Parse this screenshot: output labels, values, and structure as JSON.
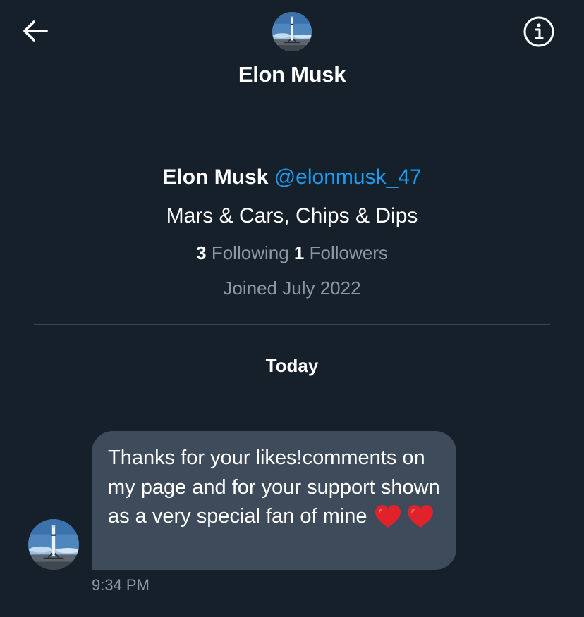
{
  "header": {
    "title": "Elon Musk",
    "back_icon": "arrow-left-icon",
    "info_icon": "info-circle-icon"
  },
  "profile": {
    "name": "Elon Musk",
    "handle": "@elonmusk_47",
    "bio": "Mars & Cars, Chips & Dips",
    "following_count": "3",
    "following_label": "Following",
    "followers_count": "1",
    "followers_label": "Followers",
    "joined": "Joined July 2022"
  },
  "conversation": {
    "day_label": "Today",
    "messages": [
      {
        "text": "Thanks for your likes!comments on my page and for your support shown as a very special fan of mine",
        "emoji": [
          "❤️",
          "❤️"
        ],
        "time": "9:34 PM"
      }
    ]
  },
  "colors": {
    "background": "#15202b",
    "accent": "#1d9bf0",
    "bubble": "#3d4b5a",
    "secondary_text": "#8b98a5",
    "divider": "#38444d"
  }
}
